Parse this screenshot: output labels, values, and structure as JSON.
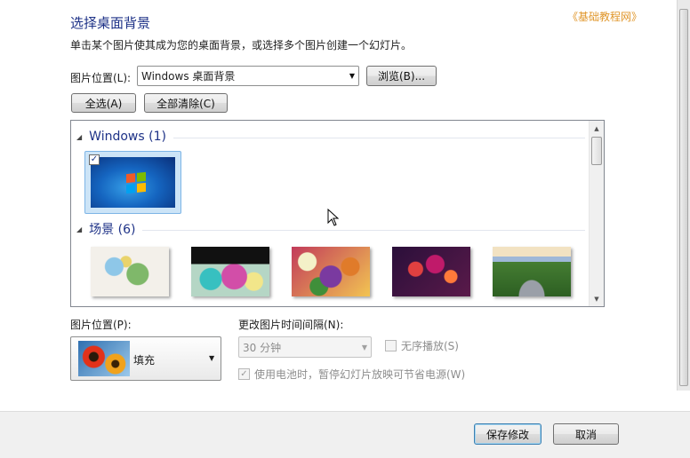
{
  "page": {
    "title": "选择桌面背景",
    "subtitle": "单击某个图片使其成为您的桌面背景，或选择多个图片创建一个幻灯片。",
    "watermark": "《基础教程网》"
  },
  "location": {
    "label": "图片位置(L):",
    "value": "Windows 桌面背景",
    "browse_label": "浏览(B)..."
  },
  "selection": {
    "select_all_label": "全选(A)",
    "clear_all_label": "全部清除(C)"
  },
  "gallery": {
    "groups": [
      {
        "title": "Windows (1)"
      },
      {
        "title": "场景 (6)"
      }
    ],
    "windows_item_checked": "✓"
  },
  "position": {
    "label": "图片位置(P):",
    "value": "填充"
  },
  "interval": {
    "label": "更改图片时间间隔(N):",
    "value": "30 分钟",
    "shuffle_label": "无序播放(S)",
    "battery_label": "使用电池时，暂停幻灯片放映可节省电源(W)",
    "battery_checked": "✓"
  },
  "footer": {
    "save_label": "保存修改",
    "cancel_label": "取消"
  },
  "icons": {
    "dropdown": "▼",
    "collapse": "◢",
    "scroll_up": "▲",
    "scroll_down": "▼"
  }
}
